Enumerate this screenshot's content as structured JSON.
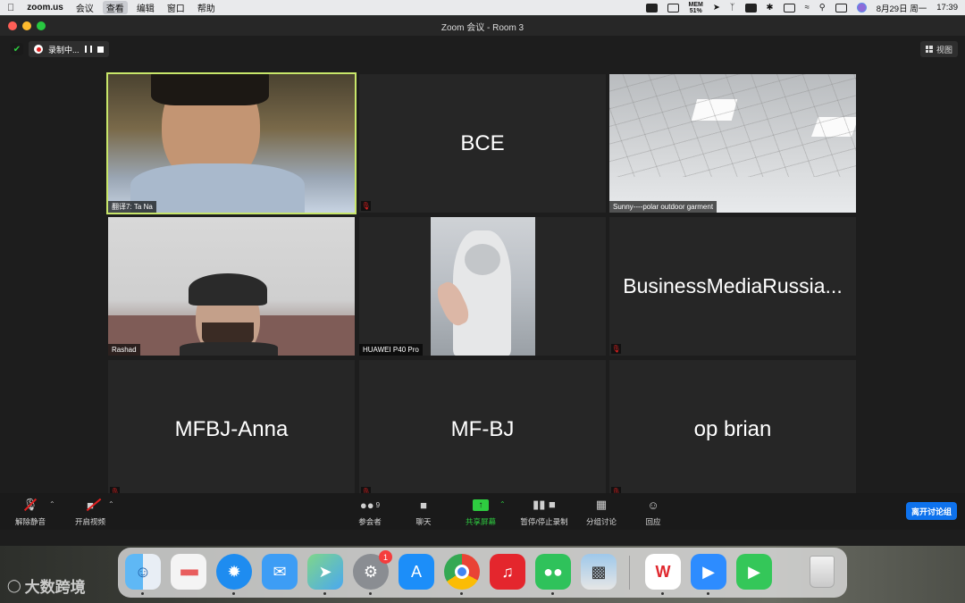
{
  "menubar": {
    "app": "zoom.us",
    "items": [
      "会议",
      "查看",
      "编辑",
      "窗口",
      "帮助"
    ],
    "mem_label": "MEM",
    "mem_value": "51%",
    "date": "8月29日 周一",
    "time": "17:39"
  },
  "window": {
    "title": "Zoom 会议 - Room 3",
    "recording_label": "录制中...",
    "view_label": "视图"
  },
  "participants": [
    {
      "name": "翻译7: Ta Na",
      "type": "video",
      "active": true
    },
    {
      "name": "BCE",
      "type": "name",
      "muted": true
    },
    {
      "name": "Sunny----polar outdoor garment",
      "type": "video"
    },
    {
      "name": "Rashad",
      "type": "video"
    },
    {
      "name": "HUAWEI P40 Pro",
      "type": "video"
    },
    {
      "name": "BusinessMediaRussia...",
      "type": "name",
      "muted": true
    },
    {
      "name": "MFBJ-Anna",
      "type": "name",
      "muted": true
    },
    {
      "name": "MF-BJ",
      "type": "name",
      "muted": true
    },
    {
      "name": "op brian",
      "type": "name",
      "muted": true
    }
  ],
  "toolbar": {
    "unmute": "解除静音",
    "start_video": "开启视频",
    "participants": "参会者",
    "participants_count": "9",
    "chat": "聊天",
    "share": "共享屏幕",
    "pause_stop_rec": "暂停/停止录制",
    "breakout": "分组讨论",
    "reactions": "回应",
    "leave_breakout": "离开讨论组"
  },
  "dock": {
    "system_prefs_badge": "1"
  },
  "watermark": "大数跨境",
  "colors": {
    "active_speaker": "#c8e66a",
    "share_green": "#2ecc40",
    "breakout_blue": "#0e72ed"
  }
}
